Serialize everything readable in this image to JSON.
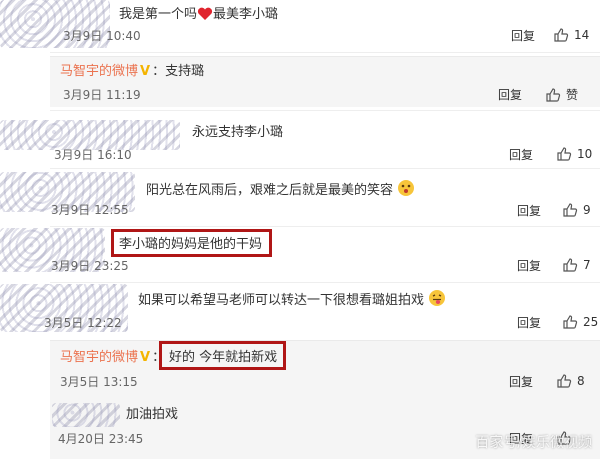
{
  "comments": [
    {
      "text": "我是第一个吗",
      "text2": "最美李小璐",
      "time": "3月9日 10:40",
      "reply": "回复",
      "likes": "14"
    },
    {
      "name": "马智宇的微博",
      "v": "V",
      "text": "：支持璐",
      "time": "3月9日 11:19",
      "reply": "回复",
      "likes": "赞"
    },
    {
      "text": "永远支持李小璐",
      "time": "3月9日 16:10",
      "reply": "回复",
      "likes": "10"
    },
    {
      "text": "阳光总在风雨后，艰难之后就是最美的笑容",
      "time": "3月9日 12:55",
      "reply": "回复",
      "likes": "9"
    },
    {
      "text": "李小璐的妈妈是他的干妈",
      "time": "3月9日 23:25",
      "reply": "回复",
      "likes": "7"
    },
    {
      "text": "如果可以希望马老师可以转达一下很想看璐姐拍戏",
      "time": "3月5日 12:22",
      "reply": "回复",
      "likes": "25"
    },
    {
      "name": "马智宇的微博",
      "v": "V",
      "text": "好的 今年就拍新戏",
      "time": "3月5日 13:15",
      "reply": "回复",
      "likes": "8"
    },
    {
      "text": "加油拍戏",
      "time": "4月20日 23:45",
      "reply": "回复",
      "likes": ""
    }
  ],
  "watermark": "百家号/娱乐微视频",
  "colors": {
    "name": "#eb7350",
    "highlight": "#b01616",
    "vbadge": "#f4b400"
  }
}
